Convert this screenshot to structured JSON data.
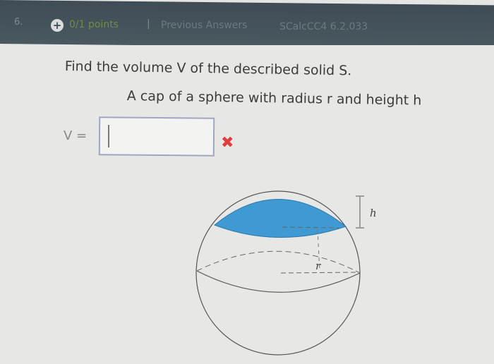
{
  "header": {
    "question_number": "6.",
    "points": "0/1 points",
    "separator": "|",
    "previous_answers": "Previous Answers",
    "reference": "SCalcCC4 6.2.033"
  },
  "question": {
    "prompt": "Find the volume V of the described solid S.",
    "description": "A cap of a sphere with radius r and height h",
    "answer_label": "V =",
    "answer_value": "",
    "result_mark": "✖"
  },
  "figure": {
    "height_label": "h",
    "radius_label": "r",
    "cap_color": "#3f9ad3"
  }
}
